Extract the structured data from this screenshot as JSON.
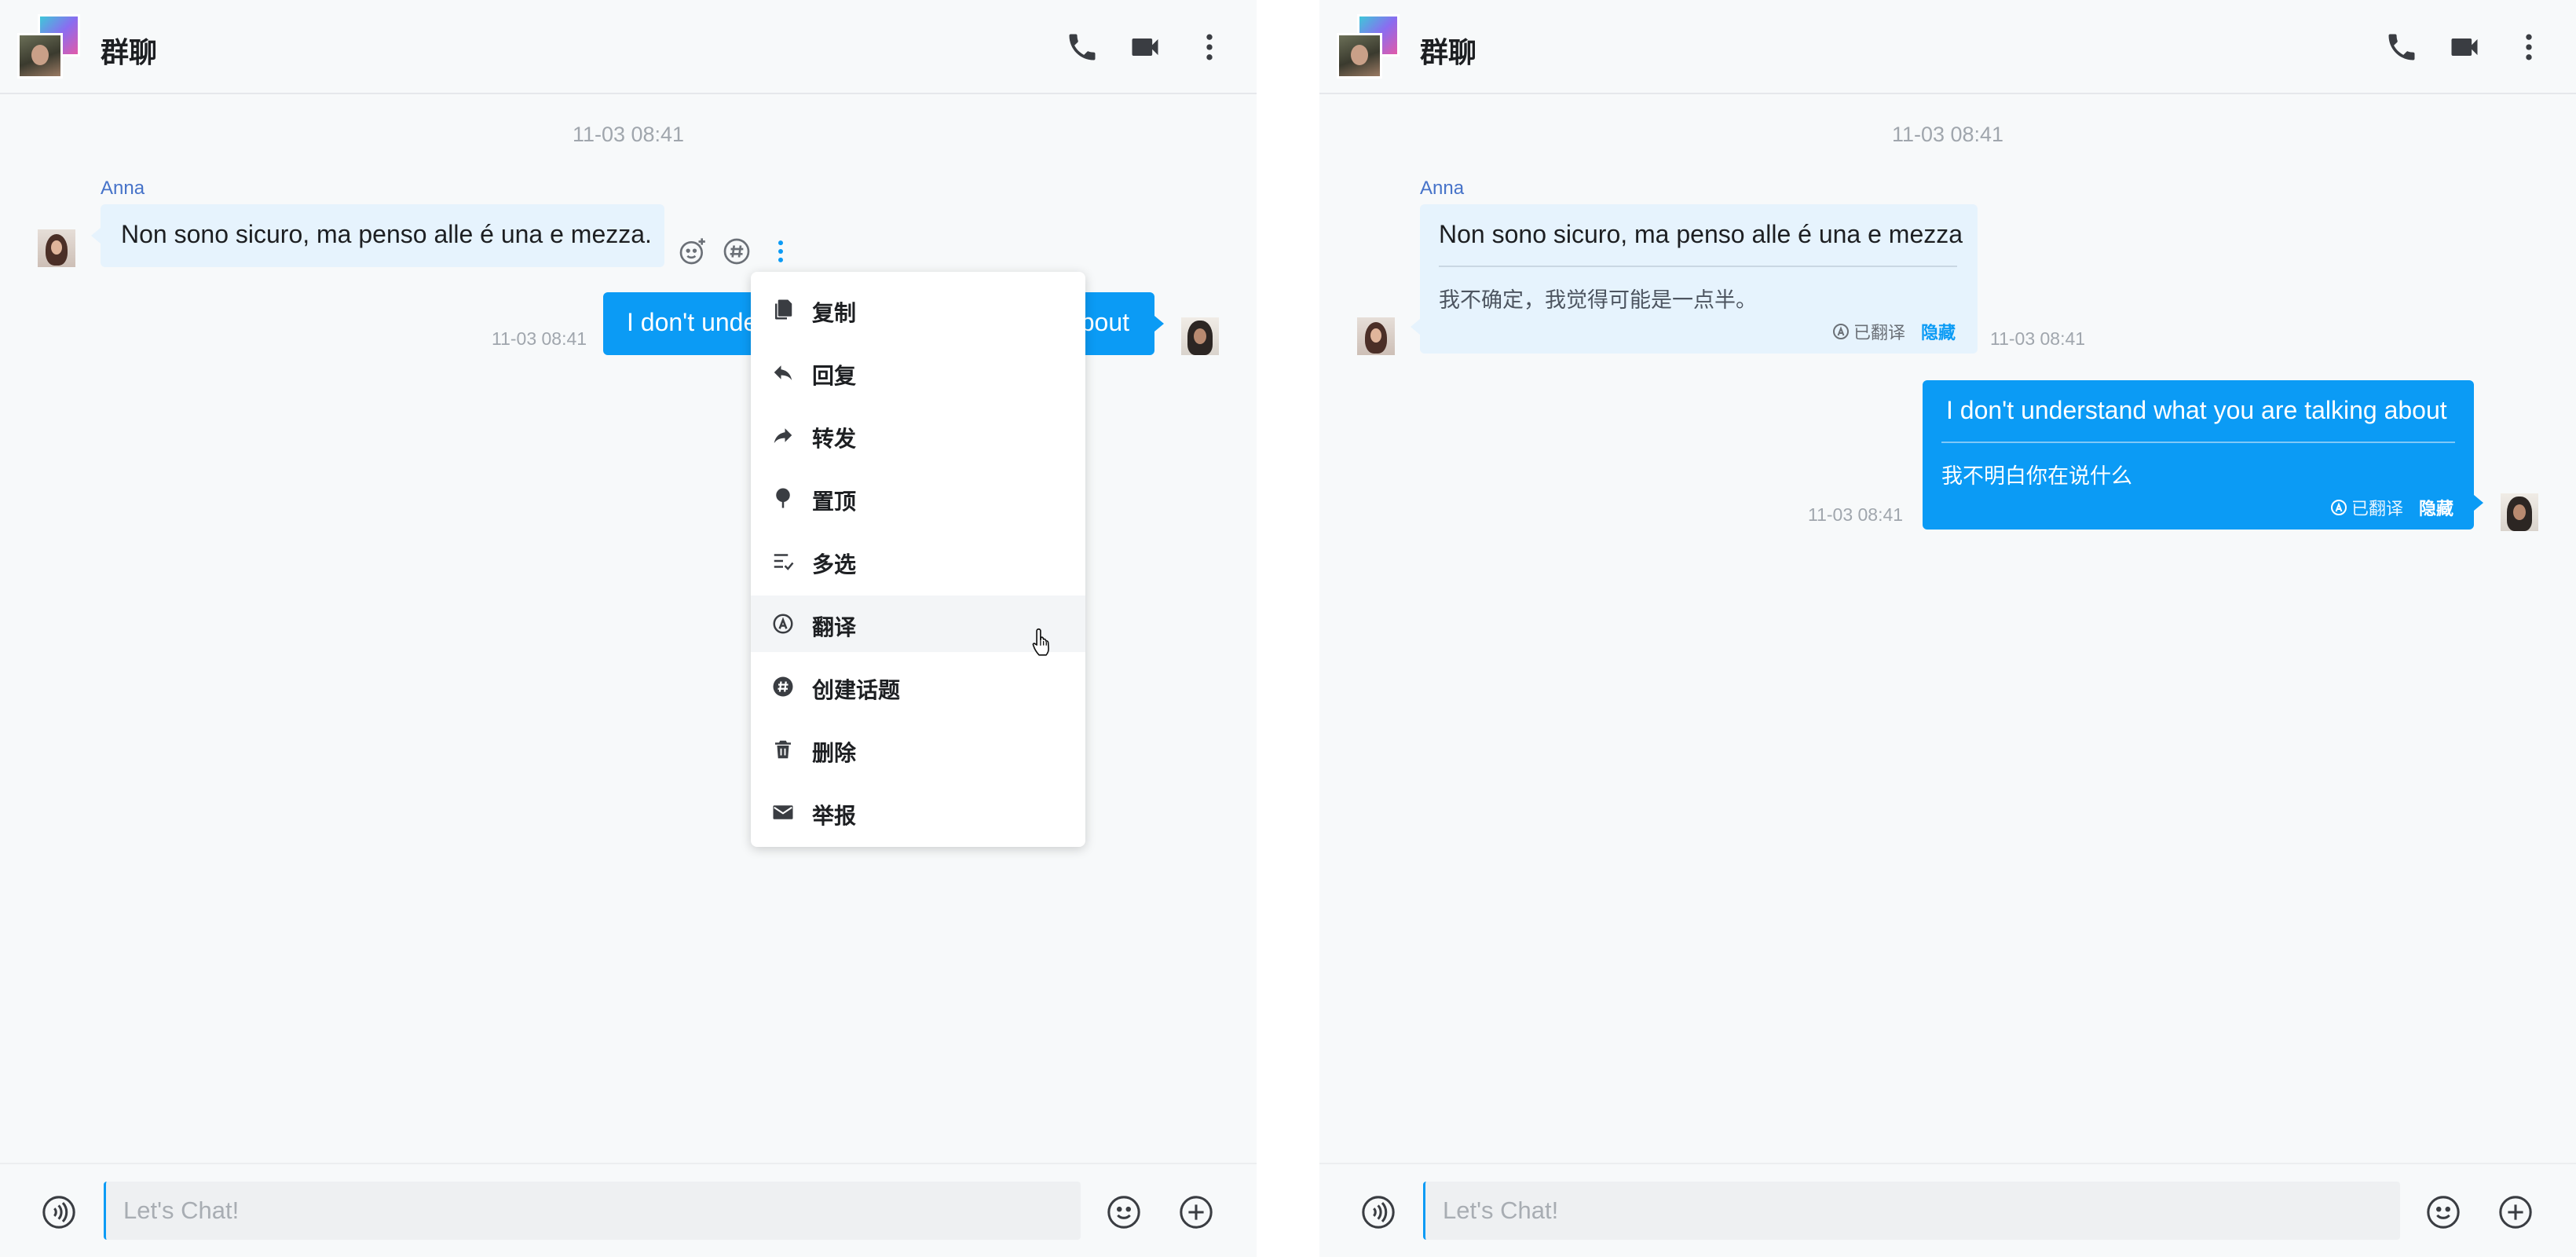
{
  "accent_color": "#0b9bf5",
  "left": {
    "header": {
      "title": "群聊",
      "icons": [
        "phone-icon",
        "video-camera-icon",
        "more-vertical-icon"
      ]
    },
    "time_divider": "11-03 08:41",
    "incoming": {
      "sender": "Anna",
      "text": "Non sono sicuro, ma penso alle é una e mezza."
    },
    "outgoing": {
      "text_left": "I don't unde",
      "text_right": "about",
      "time": "11-03 08:41"
    },
    "hover_tools": [
      "add-reaction-icon",
      "topic-hash-icon",
      "more-vertical-icon"
    ],
    "context_menu": [
      {
        "label": "复制",
        "icon": "copy-icon"
      },
      {
        "label": "回复",
        "icon": "reply-icon"
      },
      {
        "label": "转发",
        "icon": "forward-icon"
      },
      {
        "label": "置顶",
        "icon": "pin-icon"
      },
      {
        "label": "多选",
        "icon": "multi-select-icon"
      },
      {
        "label": "翻译",
        "icon": "translate-icon"
      },
      {
        "label": "创建话题",
        "icon": "hash-icon"
      },
      {
        "label": "删除",
        "icon": "trash-icon"
      },
      {
        "label": "举报",
        "icon": "mail-icon"
      }
    ],
    "footer": {
      "placeholder": "Let's Chat!"
    }
  },
  "right": {
    "header": {
      "title": "群聊"
    },
    "time_divider": "11-03 08:41",
    "incoming": {
      "sender": "Anna",
      "text": "Non sono sicuro, ma penso alle é una e mezza",
      "translation": "我不确定，我觉得可能是一点半。",
      "status": "已翻译",
      "hide": "隐藏",
      "time": "11-03 08:41"
    },
    "outgoing": {
      "text": "I don't understand what you are talking about",
      "translation": "我不明白你在说什么",
      "status": "已翻译",
      "hide": "隐藏",
      "time": "11-03 08:41"
    },
    "footer": {
      "placeholder": "Let's Chat!"
    }
  }
}
